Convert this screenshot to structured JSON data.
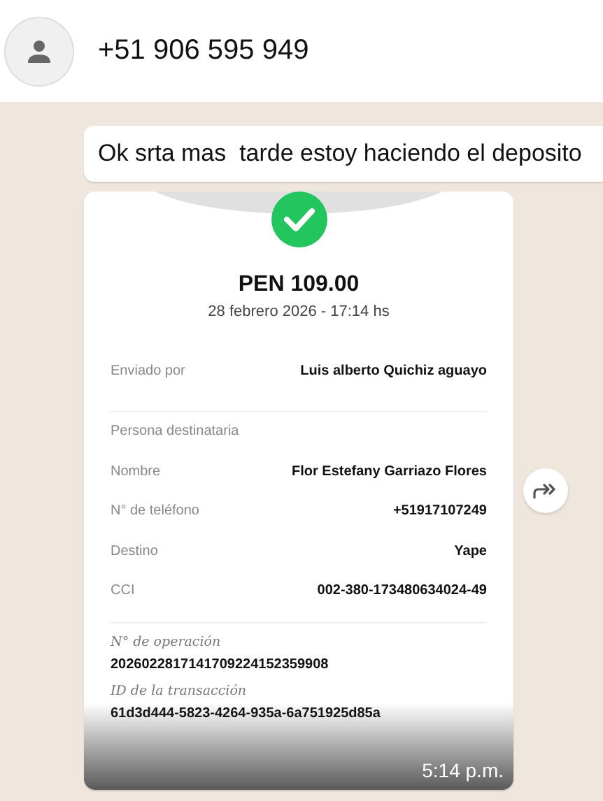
{
  "header": {
    "contact": "+51 906 595 949"
  },
  "messages": [
    {
      "kind": "text",
      "text": "Ok srta mas  tarde estoy haciendo el deposito"
    },
    {
      "kind": "receipt",
      "amount": "PEN 109.00",
      "date": "28 febrero 2026 - 17:14 hs",
      "sender": {
        "label": "Enviado por",
        "value": "Luis alberto Quichiz aguayo"
      },
      "section_title": "Persona destinataria",
      "rows": [
        {
          "label": "Nombre",
          "value": "Flor Estefany Garriazo Flores"
        },
        {
          "label": "N° de teléfono",
          "value": "+51917107249"
        },
        {
          "label": "Destino",
          "value": "Yape"
        },
        {
          "label": "CCI",
          "value": "002-380-173480634024-49"
        }
      ],
      "operation": {
        "label": "N° de operación",
        "value": "2026022817141709224152359908"
      },
      "transaction": {
        "label": "ID de la transacción",
        "value": "61d3d444-5823-4264-935a-6a751925d85a"
      },
      "time": "5:14 p.m."
    }
  ]
}
